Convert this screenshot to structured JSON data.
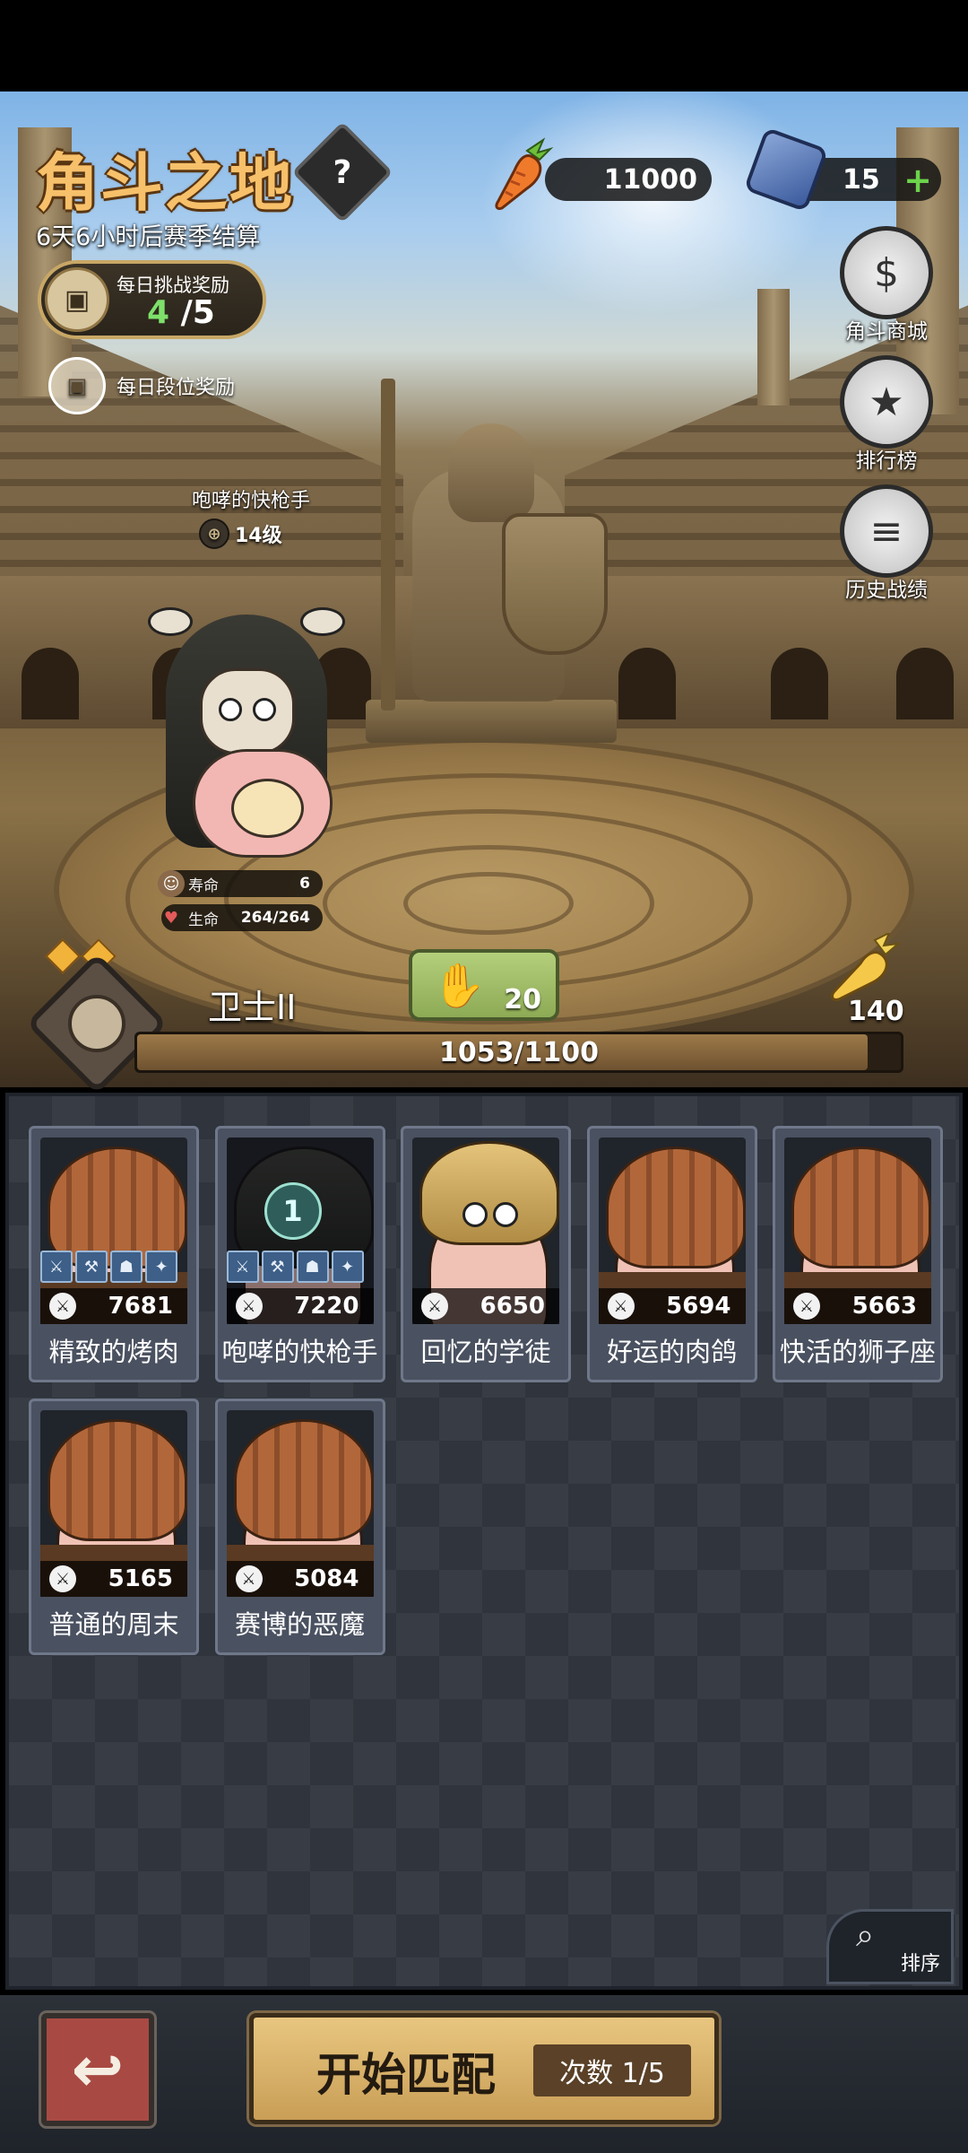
{
  "header": {
    "title": "角斗之地",
    "help_icon": "?",
    "season_text": "6天6小时后赛季结算",
    "daily_challenge": {
      "label": "每日挑战奖励",
      "current": "4",
      "total": "/5"
    },
    "daily_rank_label": "每日段位奖励"
  },
  "currency": {
    "carrots": "11000",
    "gems": "15",
    "plus_icon": "+"
  },
  "side_menu": [
    {
      "label": "角斗商城",
      "icon": "money-bag-icon",
      "glyph": "$"
    },
    {
      "label": "排行榜",
      "icon": "trophy-icon",
      "glyph": "★"
    },
    {
      "label": "历史战绩",
      "icon": "scroll-icon",
      "glyph": "≡"
    }
  ],
  "hero": {
    "name": "咆哮的快枪手",
    "level": "14级",
    "lifespan_label": "寿命",
    "lifespan": "6",
    "hp_label": "生命",
    "hp": "264/264"
  },
  "rank": {
    "name": "卫士II",
    "power": "20",
    "carrot_reward": "140",
    "xp_text": "1053/1100",
    "xp_fraction": 0.957
  },
  "opponents": [
    {
      "name": "精致的烤肉",
      "power": "7681",
      "hood": "pumpkin",
      "equip": true
    },
    {
      "name": "咆哮的快枪手",
      "power": "7220",
      "hood": "cloak",
      "equip": true,
      "badge": "1"
    },
    {
      "name": "回忆的学徒",
      "power": "6650",
      "hood": "blonde",
      "equip": false
    },
    {
      "name": "好运的肉鸽",
      "power": "5694",
      "hood": "pumpkin",
      "equip": false
    },
    {
      "name": "快活的狮子座",
      "power": "5663",
      "hood": "pumpkin",
      "equip": false
    },
    {
      "name": "普通的周末",
      "power": "5165",
      "hood": "pumpkin",
      "equip": false
    },
    {
      "name": "赛博的恶魔",
      "power": "5084",
      "hood": "pumpkin",
      "equip": false
    }
  ],
  "sort_label": "排序",
  "bottom": {
    "match_label": "开始匹配",
    "match_count": "次数 1/5"
  },
  "colors": {
    "title": "#f7c06a",
    "accent_green": "#6bd44a",
    "panel": "#2f343d"
  }
}
